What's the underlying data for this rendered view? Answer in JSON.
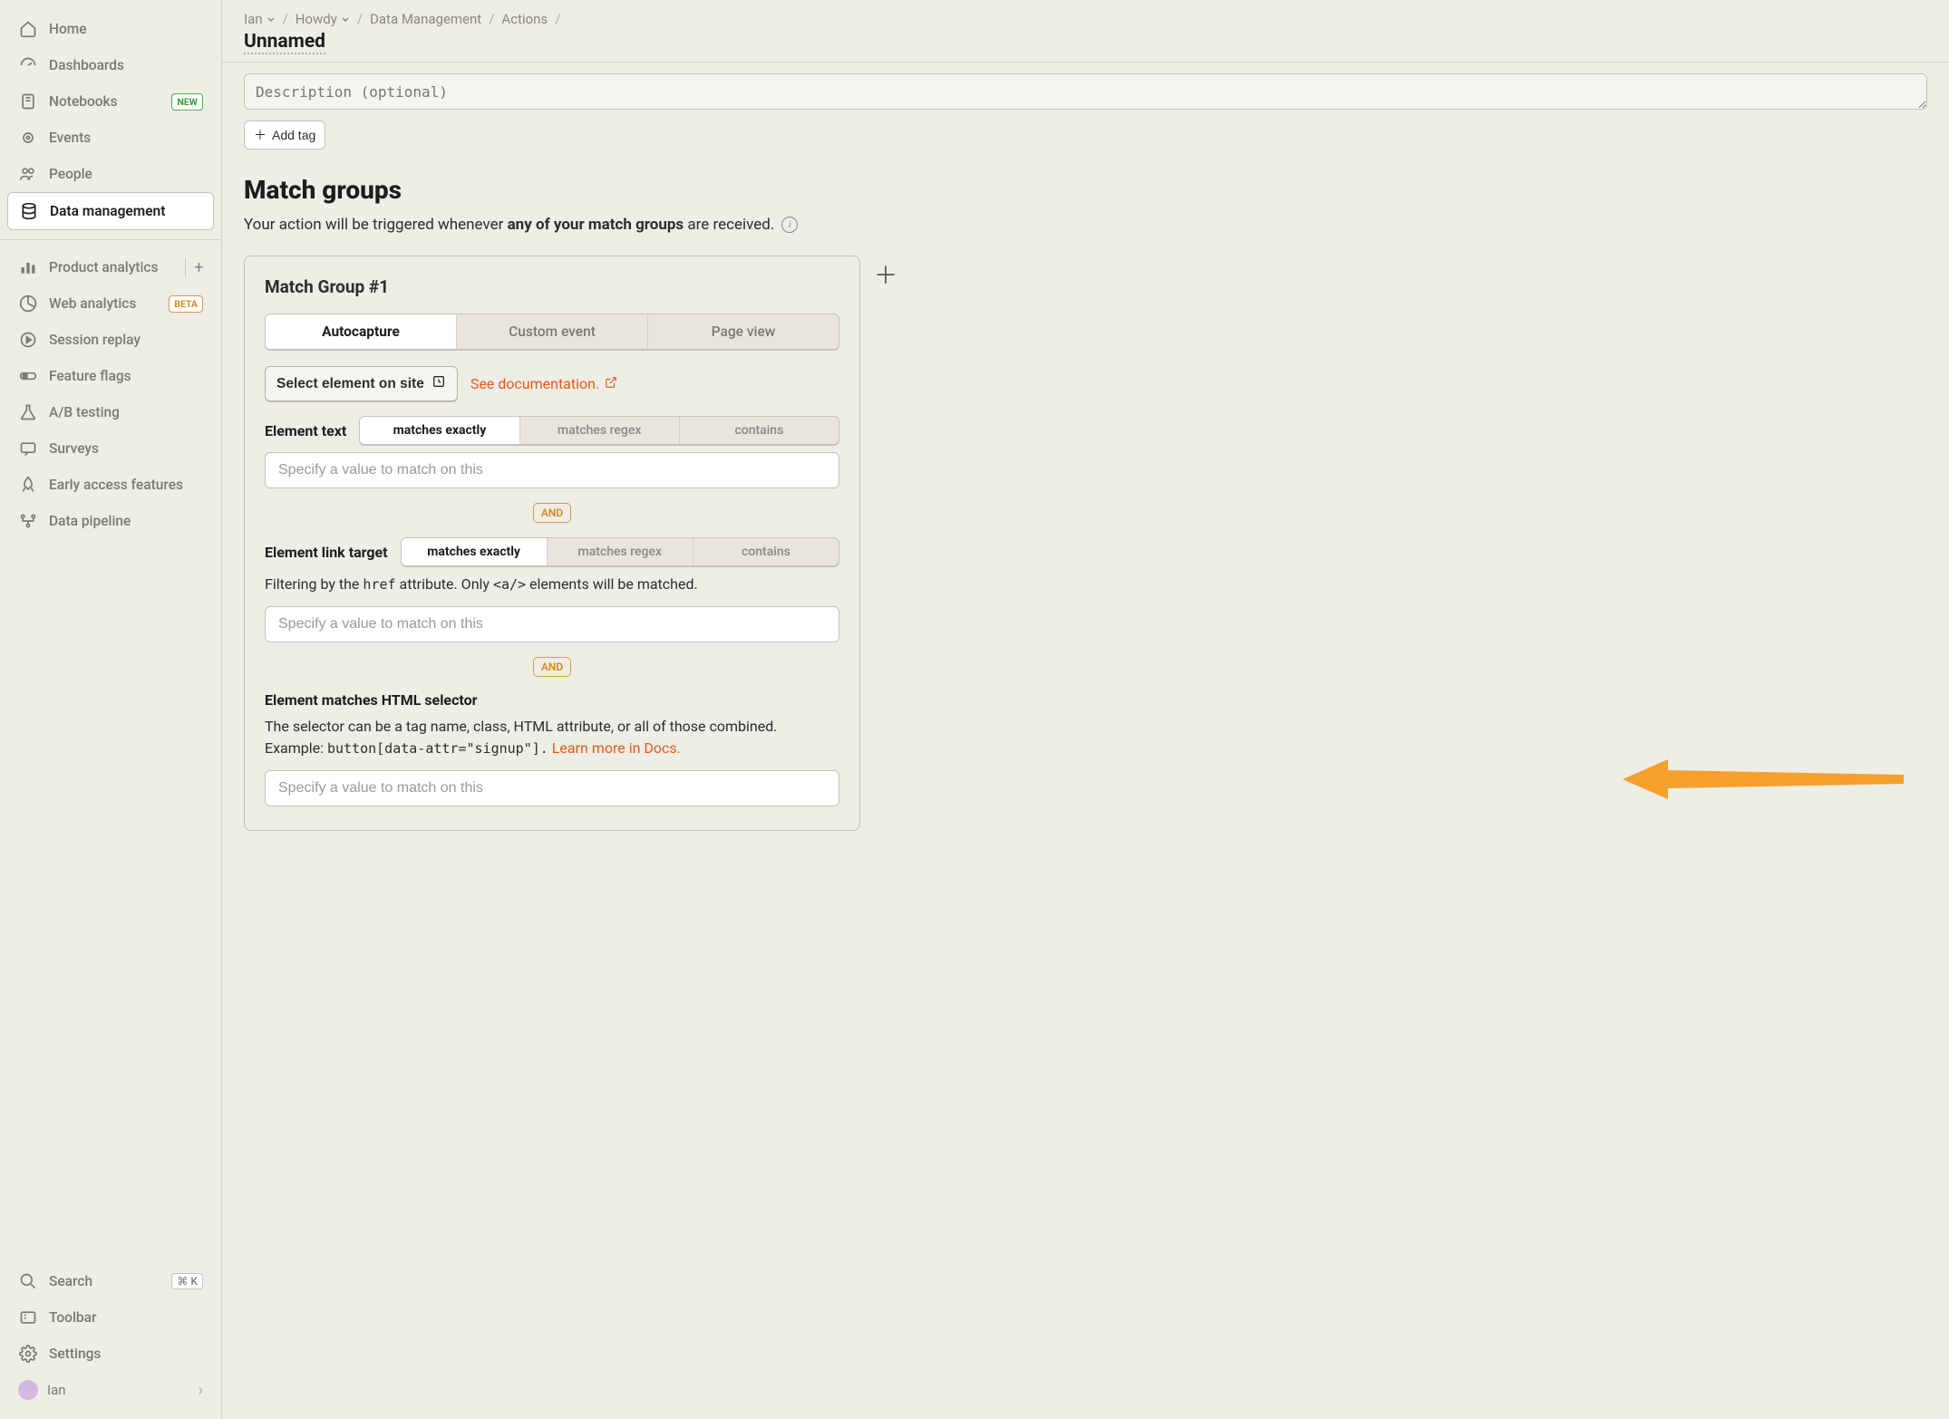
{
  "sidebar": {
    "nav1": [
      {
        "icon": "home",
        "label": "Home"
      },
      {
        "icon": "gauge",
        "label": "Dashboards"
      },
      {
        "icon": "notebook",
        "label": "Notebooks",
        "badge": "NEW"
      },
      {
        "icon": "broadcast",
        "label": "Events"
      },
      {
        "icon": "people",
        "label": "People"
      },
      {
        "icon": "database",
        "label": "Data management",
        "active": true
      }
    ],
    "nav2": [
      {
        "icon": "bars",
        "label": "Product analytics",
        "plus": true
      },
      {
        "icon": "pie",
        "label": "Web analytics",
        "badge": "BETA"
      },
      {
        "icon": "play",
        "label": "Session replay"
      },
      {
        "icon": "toggle",
        "label": "Feature flags"
      },
      {
        "icon": "flask",
        "label": "A/B testing"
      },
      {
        "icon": "chat",
        "label": "Surveys"
      },
      {
        "icon": "rocket",
        "label": "Early access features"
      },
      {
        "icon": "pipeline",
        "label": "Data pipeline"
      }
    ],
    "bottom": {
      "search": "Search",
      "shortcut": "⌘ K",
      "toolbar": "Toolbar",
      "settings": "Settings",
      "user": "Ian"
    }
  },
  "breadcrumb": [
    "Ian",
    "Howdy",
    "Data Management",
    "Actions"
  ],
  "page_title": "Unnamed",
  "description_placeholder": "Description (optional)",
  "add_tag": "Add tag",
  "section": {
    "title": "Match groups",
    "desc_pre": "Your action will be triggered whenever ",
    "desc_strong": "any of your match groups",
    "desc_post": " are received."
  },
  "card": {
    "title": "Match Group #1",
    "tabs": [
      "Autocapture",
      "Custom event",
      "Page view"
    ],
    "select_element": "Select element on site",
    "see_docs": "See documentation.",
    "element_text": {
      "label": "Element text",
      "segments": [
        "matches exactly",
        "matches regex",
        "contains"
      ],
      "placeholder": "Specify a value to match on this"
    },
    "and": "AND",
    "element_link": {
      "label": "Element link target",
      "segments": [
        "matches exactly",
        "matches regex",
        "contains"
      ],
      "help_pre": "Filtering by the ",
      "help_code1": "href",
      "help_mid": " attribute. Only ",
      "help_code2": "<a/>",
      "help_post": " elements will be matched.",
      "placeholder": "Specify a value to match on this"
    },
    "selector": {
      "label": "Element matches HTML selector",
      "help": "The selector can be a tag name, class, HTML attribute, or all of those combined. Example: ",
      "help_code": "button[data-attr=\"signup\"].",
      "learn_more": "Learn more in Docs.",
      "placeholder": "Specify a value to match on this"
    }
  }
}
